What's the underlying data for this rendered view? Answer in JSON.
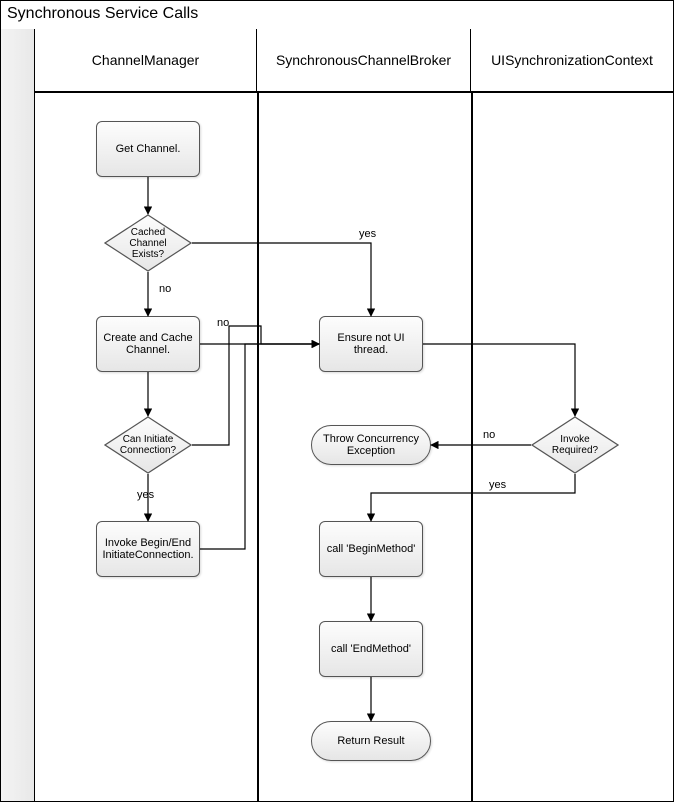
{
  "title": "Synchronous Service Calls",
  "lanes": {
    "l1": "ChannelManager",
    "l2": "SynchronousChannelBroker",
    "l3": "UISynchronizationContext"
  },
  "nodes": {
    "getChannel": "Get Channel.",
    "cachedExists": "Cached Channel Exists?",
    "createCache": "Create and Cache Channel.",
    "canInitiate": "Can Initiate Connection?",
    "invokeBeginEnd": "Invoke Begin/End InitiateConnection.",
    "ensureNotUI": "Ensure not UI thread.",
    "invokeRequired": "Invoke Required?",
    "throwConcurrency": "Throw Concurrency Exception",
    "callBegin": "call 'BeginMethod'",
    "callEnd": "call 'EndMethod'",
    "returnResult": "Return Result"
  },
  "edges": {
    "yes": "yes",
    "no": "no"
  },
  "chart_data": {
    "type": "flowchart",
    "title": "Synchronous Service Calls",
    "swimlanes": [
      "ChannelManager",
      "SynchronousChannelBroker",
      "UISynchronizationContext"
    ],
    "nodes": [
      {
        "id": "getChannel",
        "lane": "ChannelManager",
        "type": "process",
        "label": "Get Channel."
      },
      {
        "id": "cachedExists",
        "lane": "ChannelManager",
        "type": "decision",
        "label": "Cached Channel Exists?"
      },
      {
        "id": "createCache",
        "lane": "ChannelManager",
        "type": "process",
        "label": "Create and Cache Channel."
      },
      {
        "id": "canInitiate",
        "lane": "ChannelManager",
        "type": "decision",
        "label": "Can Initiate Connection?"
      },
      {
        "id": "invokeBeginEnd",
        "lane": "ChannelManager",
        "type": "process",
        "label": "Invoke Begin/End InitiateConnection."
      },
      {
        "id": "ensureNotUI",
        "lane": "SynchronousChannelBroker",
        "type": "process",
        "label": "Ensure not UI thread."
      },
      {
        "id": "invokeRequired",
        "lane": "UISynchronizationContext",
        "type": "decision",
        "label": "Invoke Required?"
      },
      {
        "id": "throwConcurrency",
        "lane": "SynchronousChannelBroker",
        "type": "terminator",
        "label": "Throw Concurrency Exception"
      },
      {
        "id": "callBegin",
        "lane": "SynchronousChannelBroker",
        "type": "process",
        "label": "call 'BeginMethod'"
      },
      {
        "id": "callEnd",
        "lane": "SynchronousChannelBroker",
        "type": "process",
        "label": "call 'EndMethod'"
      },
      {
        "id": "returnResult",
        "lane": "SynchronousChannelBroker",
        "type": "terminator",
        "label": "Return Result"
      }
    ],
    "edges": [
      {
        "from": "getChannel",
        "to": "cachedExists"
      },
      {
        "from": "cachedExists",
        "to": "ensureNotUI",
        "label": "yes"
      },
      {
        "from": "cachedExists",
        "to": "createCache",
        "label": "no"
      },
      {
        "from": "createCache",
        "to": "ensureNotUI"
      },
      {
        "from": "createCache",
        "to": "canInitiate"
      },
      {
        "from": "canInitiate",
        "to": "invokeBeginEnd",
        "label": "yes"
      },
      {
        "from": "canInitiate",
        "to": "ensureNotUI",
        "label": "no"
      },
      {
        "from": "invokeBeginEnd",
        "to": "ensureNotUI"
      },
      {
        "from": "ensureNotUI",
        "to": "invokeRequired"
      },
      {
        "from": "invokeRequired",
        "to": "throwConcurrency",
        "label": "no"
      },
      {
        "from": "invokeRequired",
        "to": "callBegin",
        "label": "yes"
      },
      {
        "from": "callBegin",
        "to": "callEnd"
      },
      {
        "from": "callEnd",
        "to": "returnResult"
      }
    ]
  }
}
